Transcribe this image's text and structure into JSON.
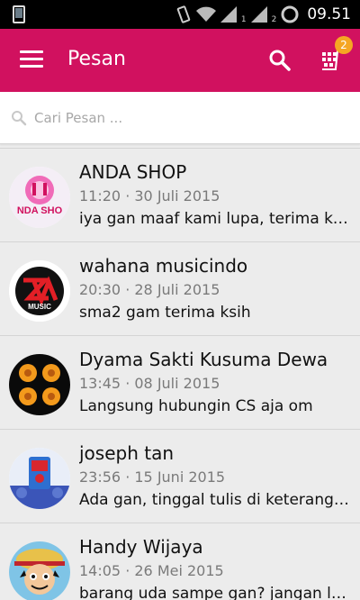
{
  "status_bar": {
    "time": "09.51",
    "sim1": "1",
    "sim2": "2"
  },
  "app_bar": {
    "title": "Pesan",
    "cart_badge": "2",
    "icons": [
      "menu-icon",
      "search-icon",
      "cart-icon"
    ]
  },
  "search": {
    "placeholder": "Cari Pesan ..."
  },
  "conversations": [
    {
      "name": "ANDA SHOP",
      "date": "11:20 · 30 Juli 2015",
      "message": "iya gan maaf kami lupa, terima kasih",
      "avatar_text": "NDA SHO"
    },
    {
      "name": "wahana musicindo",
      "date": "20:30 · 28 Juli 2015",
      "message": "sma2 gam terima ksih",
      "avatar_text": "MUSIC"
    },
    {
      "name": "Dyama Sakti Kusuma Dewa",
      "date": "13:45 · 08 Juli 2015",
      "message": "Langsung hubungin CS aja om"
    },
    {
      "name": "joseph tan",
      "date": "23:56 · 15 Juni 2015",
      "message": "Ada gan, tinggal tulis di keterangan"
    },
    {
      "name": "Handy Wijaya",
      "date": "14:05 · 26 Mei 2015",
      "message": "barang uda sampe gan? jangan lupa"
    }
  ],
  "colors": {
    "app_bar": "#d1115f",
    "badge": "#f5a623",
    "background": "#ececec"
  }
}
